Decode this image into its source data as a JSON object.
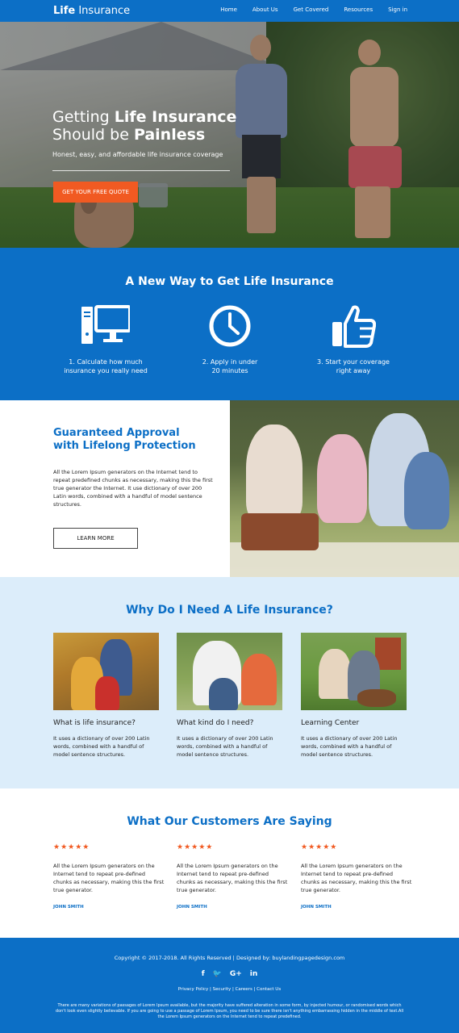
{
  "header": {
    "logo_bold": "Life",
    "logo_rest": " Insurance",
    "nav": [
      "Home",
      "About Us",
      "Get Covered",
      "Resources",
      "Sign in"
    ]
  },
  "hero": {
    "title_line1_a": "Getting ",
    "title_line1_b": "Life Insurance",
    "title_line2_a": "Should be ",
    "title_line2_b": "Painless",
    "subtitle": "Honest, easy, and affordable life insurance coverage",
    "cta": "GET YOUR FREE QUOTE"
  },
  "newway": {
    "title": "A New Way to Get Life Insurance",
    "steps": [
      {
        "line1": "1. Calculate how much",
        "line2": "insurance you really need",
        "icon": "computer-icon"
      },
      {
        "line1": "2. Apply in under",
        "line2": "20 minutes",
        "icon": "clock-icon"
      },
      {
        "line1": "3. Start your coverage",
        "line2": "right away",
        "icon": "thumbs-up-icon"
      }
    ]
  },
  "guaranteed": {
    "title_line1": "Guaranteed Approval",
    "title_line2": "with Lifelong Protection",
    "body": "All the Lorem Ipsum generators on the Internet tend to repeat predefined chunks as necessary, making this the first true generator the Internet. It use dictionary of over 200 Latin words, combined with a handful of model sentence structures.",
    "button": "LEARN MORE"
  },
  "why": {
    "title": "Why Do I Need A Life Insurance?",
    "cards": [
      {
        "title": "What is life insurance?",
        "body": "It uses a dictionary of over 200 Latin words, combined with a handful of model sentence structures."
      },
      {
        "title": "What kind do I need?",
        "body": "It uses a dictionary of over 200 Latin words, combined with a handful of model sentence structures."
      },
      {
        "title": "Learning Center",
        "body": "It uses a dictionary of over 200 Latin words, combined with a handful of model sentence structures."
      }
    ]
  },
  "testimonials": {
    "title": "What Our Customers Are Saying",
    "stars": "★★★★★",
    "items": [
      {
        "quote": "All the Lorem Ipsum generators on the Internet tend to repeat pre-defined chunks as necessary, making this the first true generator.",
        "name": "JOHN SMITH"
      },
      {
        "quote": "All the Lorem Ipsum generators on the Internet tend to repeat pre-defined chunks as necessary, making this the first true generator.",
        "name": "JOHN SMITH"
      },
      {
        "quote": "All the Lorem Ipsum generators on the Internet tend to repeat pre-defined chunks as necessary, making this the first true generator.",
        "name": "JOHN SMITH"
      }
    ]
  },
  "footer": {
    "copyright": "Copyright © 2017-2018. All Rights Reserved  |  Designed by: buylandingpagedesign.com",
    "social": [
      "f",
      "🐦",
      "G+",
      "in"
    ],
    "links": "Privacy Policy | Security | Careers | Contact Us",
    "disclaimer": "There are many variations of passages of Lorem Ipsum available, but the majority have suffered alteration in some form, by injected humour, or randomised words which don't look even slightly believable. If you are going to use a passage of Lorem Ipsum, you need to be sure there isn't anything embarrassing hidden in the middle of text.All the Lorem Ipsum generators on the Internet tend to repeat predefined."
  },
  "colors": {
    "primary": "#0c6fc6",
    "accent": "#f15a22",
    "light": "#dcedfa"
  }
}
